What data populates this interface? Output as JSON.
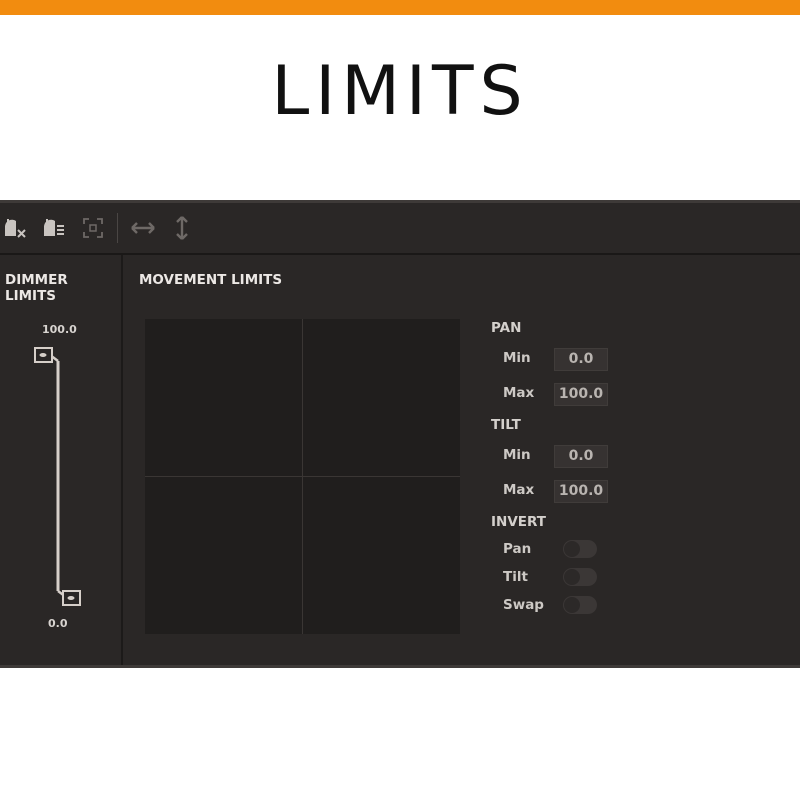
{
  "header": {
    "title": "LIMITS"
  },
  "colors": {
    "accent": "#f28c0f",
    "panel_bg": "#2a2726",
    "pad_bg": "#201e1d"
  },
  "toolbar": {
    "buttons": [
      {
        "icon": "dimmer-off-icon"
      },
      {
        "icon": "dimmer-fade-icon"
      },
      {
        "icon": "select-area-icon"
      },
      {
        "icon": "horizontal-arrows-icon"
      },
      {
        "icon": "vertical-arrows-icon"
      }
    ]
  },
  "dimmer": {
    "title": "DIMMER LIMITS",
    "max_label": "100.0",
    "min_label": "0.0",
    "upper_value": 100.0,
    "lower_value": 0.0
  },
  "movement": {
    "title": "MOVEMENT LIMITS",
    "pan": {
      "label": "PAN",
      "min_label": "Min",
      "min_value": "0.0",
      "max_label": "Max",
      "max_value": "100.0"
    },
    "tilt": {
      "label": "TILT",
      "min_label": "Min",
      "min_value": "0.0",
      "max_label": "Max",
      "max_value": "100.0"
    },
    "invert": {
      "label": "INVERT",
      "pan_label": "Pan",
      "pan_on": false,
      "tilt_label": "Tilt",
      "tilt_on": false,
      "swap_label": "Swap",
      "swap_on": false
    }
  }
}
